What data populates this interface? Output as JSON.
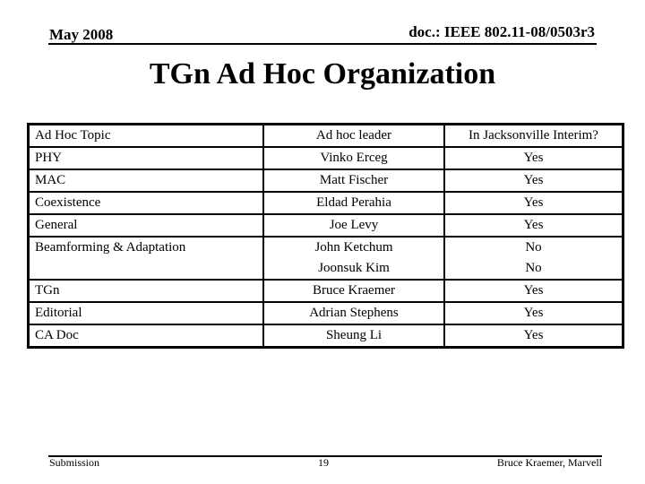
{
  "header": {
    "date": "May 2008",
    "doc_id": "doc.: IEEE 802.11-08/0503r3"
  },
  "title": "TGn Ad Hoc Organization",
  "table": {
    "columns": [
      "Ad Hoc Topic",
      "Ad hoc leader",
      "In Jacksonville Interim?"
    ],
    "rows": [
      {
        "topic": "PHY",
        "leaders": [
          "Vinko Erceg"
        ],
        "attendance": [
          "Yes"
        ]
      },
      {
        "topic": "MAC",
        "leaders": [
          "Matt Fischer"
        ],
        "attendance": [
          "Yes"
        ]
      },
      {
        "topic": "Coexistence",
        "leaders": [
          "Eldad Perahia"
        ],
        "attendance": [
          "Yes"
        ]
      },
      {
        "topic": "General",
        "leaders": [
          "Joe Levy"
        ],
        "attendance": [
          "Yes"
        ]
      },
      {
        "topic": "Beamforming & Adaptation",
        "leaders": [
          "John Ketchum",
          "Joonsuk Kim"
        ],
        "attendance": [
          "No",
          "No"
        ]
      },
      {
        "topic": "TGn",
        "leaders": [
          "Bruce Kraemer"
        ],
        "attendance": [
          "Yes"
        ]
      },
      {
        "topic": "Editorial",
        "leaders": [
          "Adrian Stephens"
        ],
        "attendance": [
          "Yes"
        ]
      },
      {
        "topic": "CA Doc",
        "leaders": [
          "Sheung Li"
        ],
        "attendance": [
          "Yes"
        ]
      }
    ]
  },
  "footer": {
    "left": "Submission",
    "page_number": "19",
    "author": "Bruce Kraemer, Marvell"
  }
}
